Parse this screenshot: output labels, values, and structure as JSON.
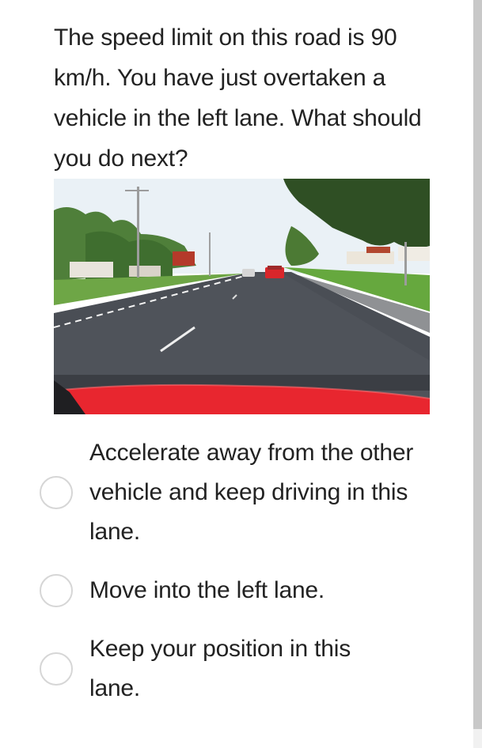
{
  "question": {
    "text": "The speed limit on this road is 90 km/h. You have just overtaken a vehicle in the left lane. What should you do next?"
  },
  "image": {
    "alt": "Dashcam view of a two-lane road with a red car ahead"
  },
  "options": [
    {
      "label": "Accelerate away from the other vehicle and keep driving in this lane.",
      "selected": false
    },
    {
      "label": "Move into the left lane.",
      "selected": false
    },
    {
      "label": "Keep your position in this lane.",
      "selected": false
    }
  ],
  "colors": {
    "text": "#222222",
    "radio_border": "#d6d6d6",
    "car_bonnet": "#e8262f",
    "road": "#4a4e55",
    "grass": "#5c9a3a",
    "sky": "#e9f1f7"
  }
}
